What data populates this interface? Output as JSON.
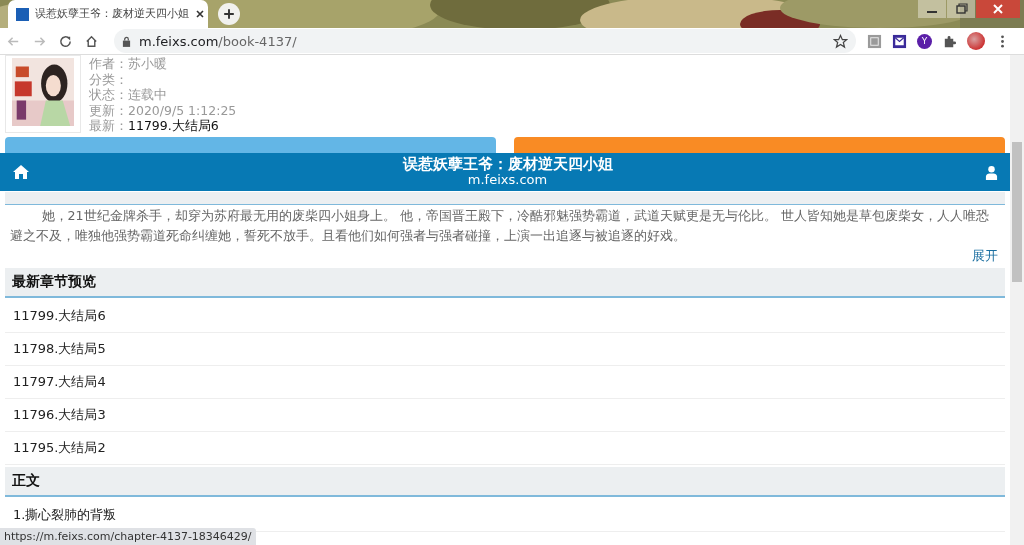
{
  "browser": {
    "tab_title": "误惹妖孽王爷：废材逆天四小姐",
    "url_host": "m.feixs.com",
    "url_path": "/book-4137/",
    "extension_letter": "Y",
    "status_url": "https://m.feixs.com/chapter-4137-18346429/"
  },
  "book": {
    "info": [
      {
        "label": "作者：",
        "value": "苏小暖",
        "emphasized": false
      },
      {
        "label": "分类：",
        "emphasized": false
      },
      {
        "label": "状态：",
        "value": "连载中",
        "emphasized": false
      },
      {
        "label": "更新：",
        "value": "2020/9/5 1:12:25",
        "emphasized": false
      },
      {
        "label": "最新：",
        "value": "11799.大结局6",
        "emphasized": true
      }
    ]
  },
  "header": {
    "title": "误惹妖孽王爷：废材逆天四小姐",
    "subtitle": "m.feixs.com"
  },
  "intro": {
    "text": "她，21世纪金牌杀手，却穿为苏府最无用的废柴四小姐身上。 他，帝国晋王殿下，冷酷邪魅强势霸道，武道天赋更是无与伦比。 世人皆知她是草包废柴女，人人唯恐避之不及，唯独他强势霸道死命纠缠她，誓死不放手。且看他们如何强者与强者碰撞，上演一出追逐与被追逐的好戏。",
    "expand": "展开"
  },
  "sections": [
    {
      "title": "最新章节预览",
      "items": [
        "11799.大结局6",
        "11798.大结局5",
        "11797.大结局4",
        "11796.大结局3",
        "11795.大结局2"
      ]
    },
    {
      "title": "正文",
      "items": [
        "1.撕心裂肺的背叛"
      ]
    }
  ]
}
